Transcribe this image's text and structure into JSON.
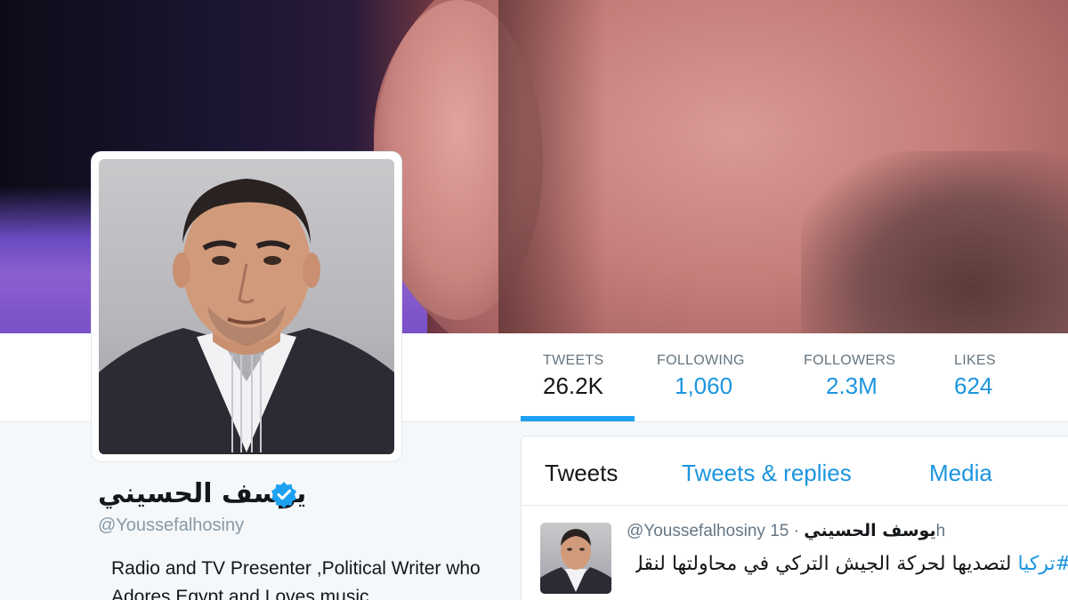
{
  "profile": {
    "name": "يوسف الحسيني",
    "screen_name": "@Youssefalhosiny",
    "bio": "Radio and TV Presenter ,Political Writer who Adores Egypt and Loves music"
  },
  "stats": [
    {
      "label": "TWEETS",
      "value": "26.2K"
    },
    {
      "label": "FOLLOWING",
      "value": "1,060"
    },
    {
      "label": "FOLLOWERS",
      "value": "2.3M"
    },
    {
      "label": "LIKES",
      "value": "624"
    }
  ],
  "timeline": {
    "tabs": [
      "Tweets",
      "Tweets & replies",
      "Media"
    ],
    "tweet": {
      "fullname": "يوسف الحسيني",
      "screen_name": "@Youssefalhosiny",
      "time": "· 15h",
      "hashtag": "#تركيا",
      "text": "لتصديها لحركة الجيش التركي في محاولتها لنقل"
    }
  },
  "colors": {
    "accent": "#1da1f2",
    "link": "#1b95e0",
    "verified": "#1da1f2"
  },
  "icons": {
    "verified": "verified-badge-icon"
  }
}
